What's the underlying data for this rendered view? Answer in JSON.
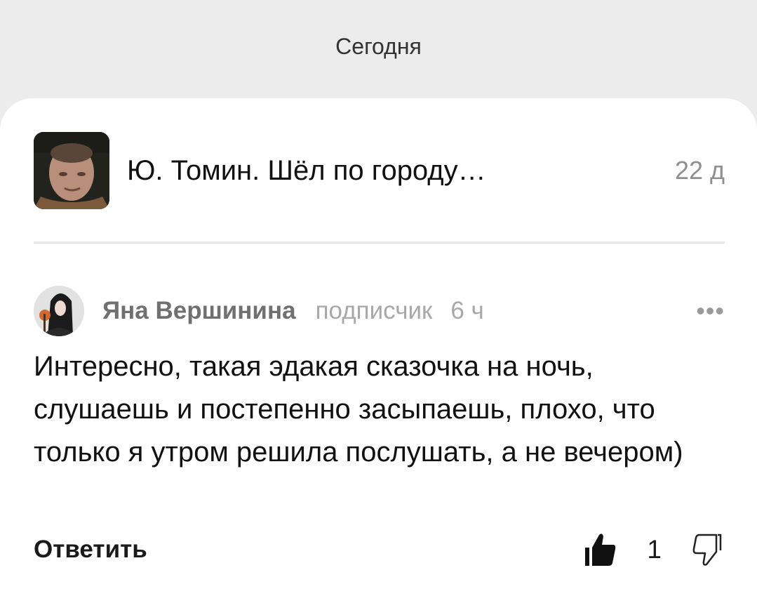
{
  "date_header": "Сегодня",
  "post": {
    "title": "Ю. Томин. Шёл по городу…",
    "age": "22 д",
    "thumbnail_icon": "author-photo"
  },
  "comment": {
    "author": "Яна Вершинина",
    "role": "подписчик",
    "time": "6 ч",
    "more_icon": "more-horizontal-icon",
    "more_label": "•••",
    "text": "Интересно, такая эдакая сказочка на ночь, слушаешь и постепенно засыпаешь, плохо, что только я утром решила послушать, а не вечером)",
    "avatar_icon": "user-avatar"
  },
  "actions": {
    "reply_label": "Ответить",
    "like_icon": "thumbs-up-icon",
    "like_count": "1",
    "dislike_icon": "thumbs-down-icon"
  },
  "colors": {
    "background": "#ececec",
    "card": "#ffffff",
    "text_primary": "#111111",
    "text_muted": "#a8a8a8"
  }
}
